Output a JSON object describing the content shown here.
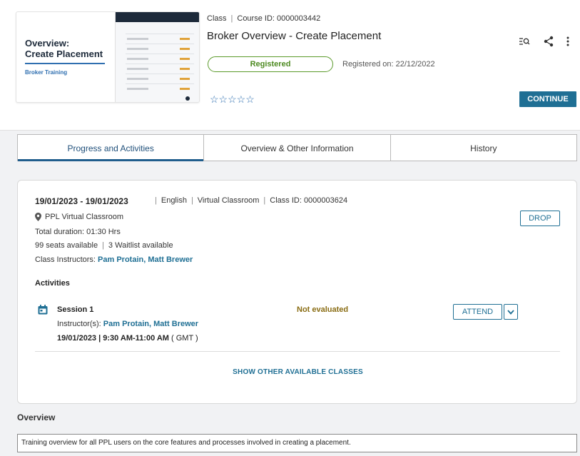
{
  "header": {
    "thumbnail": {
      "title_line1": "Overview:",
      "title_line2": "Create Placement",
      "subtitle": "Broker Training"
    },
    "type_label": "Class",
    "course_id": "Course ID: 0000003442",
    "title": "Broker Overview - Create Placement",
    "status_badge": "Registered",
    "registered_on": "Registered on: 22/12/2022",
    "rating": "☆☆☆☆☆",
    "continue_label": "CONTINUE",
    "icons": [
      "search-list-icon",
      "share-icon",
      "more-vertical-icon"
    ]
  },
  "tabs": [
    {
      "label": "Progress and Activities",
      "active": true
    },
    {
      "label": "Overview & Other Information",
      "active": false
    },
    {
      "label": "History",
      "active": false
    }
  ],
  "class_card": {
    "date_range": "19/01/2023 - 19/01/2023",
    "language": "English",
    "delivery": "Virtual Classroom",
    "class_id": "Class ID: 0000003624",
    "location": "PPL Virtual Classroom",
    "duration": "Total duration: 01:30 Hrs",
    "seats": "99 seats available",
    "waitlist": "3 Waitlist available",
    "instructors_label": "Class Instructors:",
    "instructors": "Pam Protain, Matt Brewer",
    "drop_label": "DROP",
    "activities_heading": "Activities",
    "session": {
      "name": "Session 1",
      "status": "Not evaluated",
      "instructors_label": "Instructor(s):",
      "instructors": "Pam Protain, Matt Brewer",
      "datetime": "19/01/2023 | 9:30 AM-11:00 AM",
      "timezone": "( GMT )",
      "attend_label": "ATTEND"
    },
    "show_other_label": "SHOW OTHER AVAILABLE CLASSES"
  },
  "overview": {
    "heading": "Overview",
    "text": "Training overview for all PPL users on the core features and processes involved in creating a placement."
  },
  "colors": {
    "accent": "#1f6f94",
    "registered": "#4d8a20",
    "not_evaluated": "#8a6d14",
    "panel_bg": "#f1f2f4"
  }
}
